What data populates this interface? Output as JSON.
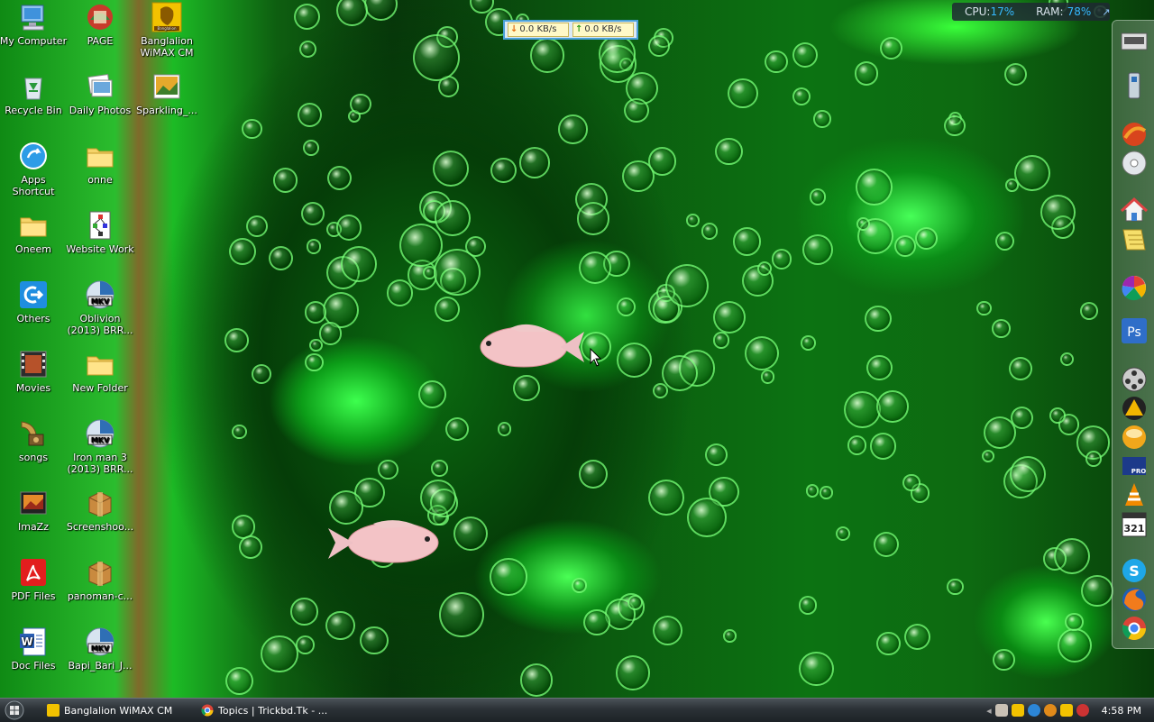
{
  "desktop": {
    "icons": [
      {
        "label": "My Computer",
        "icon": "computer-icon"
      },
      {
        "label": "PAGE",
        "icon": "page-icon"
      },
      {
        "label": "Banglalion WiMAX CM",
        "icon": "banglalion-icon"
      },
      {
        "label": "Recycle Bin",
        "icon": "recycle-bin-icon"
      },
      {
        "label": "Daily Photos",
        "icon": "photos-icon"
      },
      {
        "label": "Sparkling_...",
        "icon": "image-file-icon"
      },
      {
        "label": "Apps Shortcut",
        "icon": "apps-shortcut-icon"
      },
      {
        "label": "onne",
        "icon": "folder-icon"
      },
      {
        "label": "Oneem",
        "icon": "folder-icon"
      },
      {
        "label": "Website Work",
        "icon": "website-icon"
      },
      {
        "label": "Others",
        "icon": "others-icon"
      },
      {
        "label": "Oblivion (2013) BRR...",
        "icon": "mkv-icon"
      },
      {
        "label": "Movies",
        "icon": "movies-icon"
      },
      {
        "label": "New Folder",
        "icon": "folder-icon"
      },
      {
        "label": "songs",
        "icon": "songs-icon"
      },
      {
        "label": "Iron man 3 (2013) BRR...",
        "icon": "mkv-icon"
      },
      {
        "label": "ImaZz",
        "icon": "images-folder-icon"
      },
      {
        "label": "Screenshoo...",
        "icon": "package-icon"
      },
      {
        "label": "PDF Files",
        "icon": "pdf-icon"
      },
      {
        "label": "panoman-c...",
        "icon": "package-icon"
      },
      {
        "label": "Doc Files",
        "icon": "word-icon"
      },
      {
        "label": "Bapi_Bari_J...",
        "icon": "mkv-icon"
      }
    ],
    "mkv_badge": "MKV",
    "banglalion_text": "Banglalion"
  },
  "net_meter": {
    "download": "0.0 KB/s",
    "upload": "0.0 KB/s"
  },
  "system_monitor": {
    "cpu_label": "CPU:",
    "cpu_value": "17%",
    "ram_label": "RAM:",
    "ram_value": "78%"
  },
  "dock": {
    "items": [
      "scanner-icon",
      "usb-drive-icon",
      "browser-icon",
      "disc-icon",
      "home-icon",
      "notes-icon",
      "picasa-icon",
      "photoshop-icon",
      "film-reel-icon",
      "vlc-like-icon",
      "orb-icon",
      "media-pro-icon",
      "vlc-icon",
      "calendar-icon",
      "skype-icon",
      "firefox-icon",
      "chrome-icon"
    ],
    "ps_text": "Ps",
    "calendar_text": "321",
    "pro_text": "PRO",
    "skype_text": "S"
  },
  "taskbar": {
    "tasks": [
      {
        "label": "Banglalion WiMAX CM",
        "icon": "banglalion-icon"
      },
      {
        "label": "Topics | Trickbd.Tk - ...",
        "icon": "chrome-icon"
      }
    ],
    "clock": "4:58 PM"
  },
  "colors": {
    "wallpaper": "#0b6e11",
    "accent_blue": "#35b9ff",
    "taskbar": "#2b3136"
  }
}
